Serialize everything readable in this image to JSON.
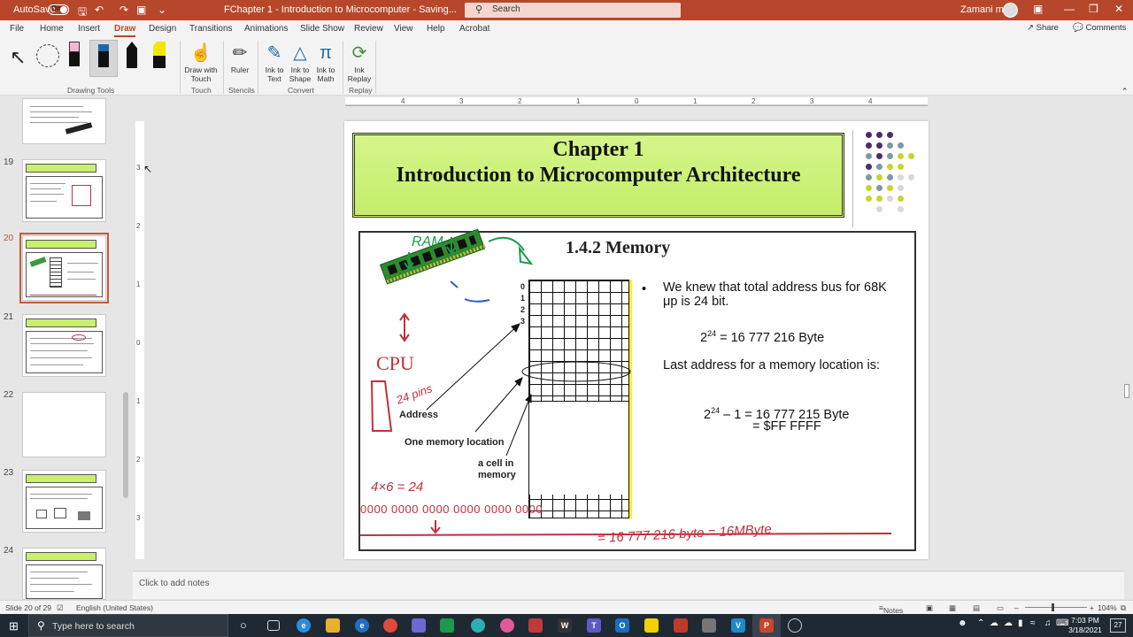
{
  "titlebar": {
    "autosave_label": "AutoSave",
    "autosave_state": "On",
    "document_title": "FChapter 1 - Introduction to Microcomputer  -  Saving...",
    "search_placeholder": "Search",
    "user_name": "Zamani ms"
  },
  "menu": {
    "tabs": [
      "File",
      "Home",
      "Insert",
      "Draw",
      "Design",
      "Transitions",
      "Animations",
      "Slide Show",
      "Review",
      "View",
      "Help",
      "Acrobat"
    ],
    "active_tab": "Draw",
    "share_label": "Share",
    "comments_label": "Comments"
  },
  "ribbon": {
    "groups": {
      "drawing_tools": "Drawing Tools",
      "touch": "Touch",
      "stencils": "Stencils",
      "convert": "Convert",
      "replay": "Replay"
    },
    "buttons": {
      "draw_with_touch": "Draw with Touch",
      "ruler": "Ruler",
      "ink_to_text": "Ink to Text",
      "ink_to_shape": "Ink to Shape",
      "ink_to_math": "Ink to Math",
      "ink_replay": "Ink Replay"
    }
  },
  "thumbnails": {
    "numbers": [
      "19",
      "20",
      "21",
      "22",
      "23",
      "24"
    ],
    "selected": "20"
  },
  "ruler": {
    "ticks": [
      "4",
      "3",
      "2",
      "1",
      "0",
      "1",
      "2",
      "3",
      "4"
    ],
    "vticks": [
      "3",
      "2",
      "1",
      "0",
      "1",
      "2",
      "3"
    ]
  },
  "slide": {
    "title_line1": "Chapter 1",
    "title_line2": "Introduction to Microcomputer Architecture",
    "section_title": "1.4.2 Memory",
    "bullet1": "We knew that total address bus for 68K μp is 24 bit.",
    "eq1_base": "2",
    "eq1_exp": "24",
    "eq1_rest": " = 16 777 216 Byte",
    "text2": "Last address for a memory location is:",
    "eq2_base": "2",
    "eq2_exp": "24",
    "eq2_rest": " – 1 = 16 777 215 Byte",
    "eq2_hex": "= $FF FFFF",
    "label_address": "Address",
    "label_one_location": "One memory location",
    "label_cell": "a cell in memory",
    "row_numbers": [
      "0",
      "1",
      "2",
      "3"
    ],
    "ink": {
      "ram": "RAM",
      "cpu": "CPU",
      "pins": "24 pins",
      "calc": "4×6 = 24",
      "binary": "0000 0000 0000 0000 0000 0000",
      "total": "= 16 777 216 byte = 16MByte"
    }
  },
  "notes_placeholder": "Click to add notes",
  "status": {
    "slide_info": "Slide 20 of 29",
    "language": "English (United States)",
    "notes_label": "Notes",
    "zoom": "104%"
  },
  "taskbar": {
    "search_placeholder": "Type here to search",
    "time": "7:03 PM",
    "date": "3/18/2021",
    "notification_count": "27"
  }
}
